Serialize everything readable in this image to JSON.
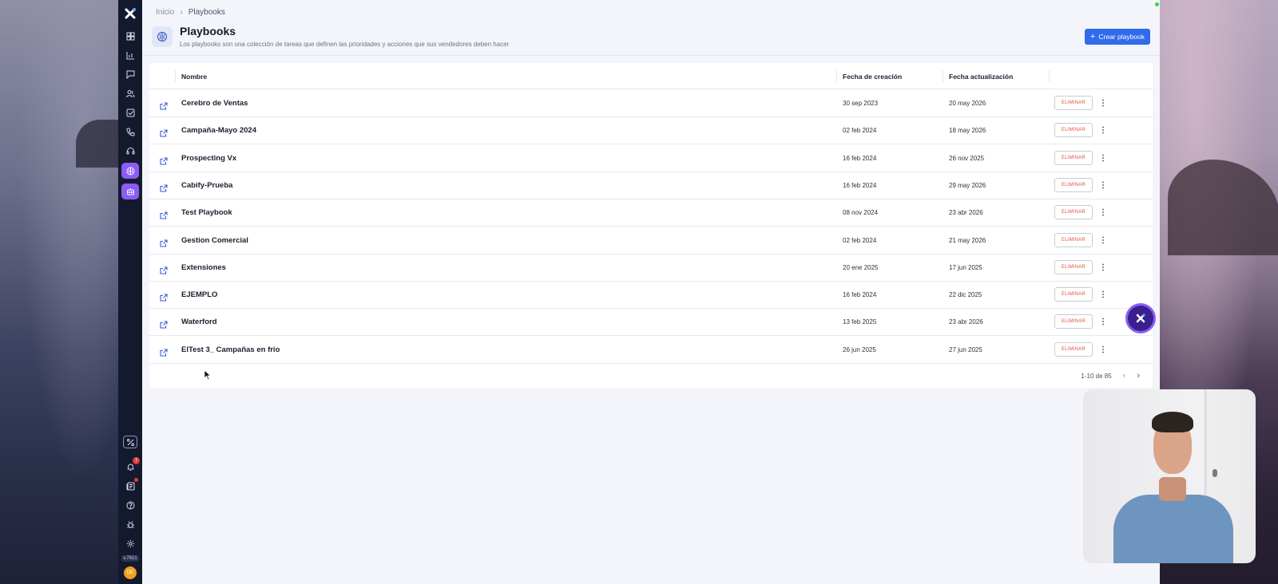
{
  "breadcrumb": {
    "home": "Inicio",
    "separator": "›",
    "current": "Playbooks"
  },
  "header": {
    "title": "Playbooks",
    "subtitle": "Los playbooks son una colección de tareas que definen las prioridades y acciones que sus vendedores deben hacer",
    "create_button": "Crear playbook",
    "icon": "brain-icon"
  },
  "table": {
    "columns": {
      "name": "Nombre",
      "created": "Fecha de creación",
      "updated": "Fecha actualización"
    },
    "delete_label": "ELIMINAR",
    "rows": [
      {
        "name": "Cerebro de Ventas",
        "created": "30 sep 2023",
        "updated": "20 may 2026"
      },
      {
        "name": "Campaña-Mayo 2024",
        "created": "02 feb 2024",
        "updated": "18 may 2026"
      },
      {
        "name": "Prospecting Vx",
        "created": "16 feb 2024",
        "updated": "26 nov 2025"
      },
      {
        "name": "Cabify-Prueba",
        "created": "16 feb 2024",
        "updated": "29 may 2026"
      },
      {
        "name": "Test Playbook",
        "created": "08 nov 2024",
        "updated": "23 abr 2026"
      },
      {
        "name": "Gestion Comercial",
        "created": "02 feb 2024",
        "updated": "21 may 2026"
      },
      {
        "name": "Extensiones",
        "created": "20 ene 2025",
        "updated": "17 jun 2025"
      },
      {
        "name": "EJEMPLO",
        "created": "16 feb 2024",
        "updated": "22 dic 2025"
      },
      {
        "name": "Waterford",
        "created": "13 feb 2025",
        "updated": "23 abr 2026"
      },
      {
        "name": "ElTest 3_ Campañas en frio",
        "created": "26 jun 2025",
        "updated": "27 jun 2025"
      }
    ]
  },
  "pagination": {
    "range": "1-10 de 85",
    "prev": "‹",
    "next": "›"
  },
  "sidebar": {
    "version": "v.7621",
    "avatar_initials": "DE",
    "notification_count": "7",
    "icons": [
      "dashboard-icon",
      "analytics-icon",
      "chat-icon",
      "contacts-icon",
      "tasks-icon",
      "phone-icon",
      "headset-icon",
      "playbooks-icon",
      "bot-icon"
    ]
  },
  "colors": {
    "accent": "#2f6bea",
    "rail": "#141a2e",
    "active": "#8b5cf6",
    "danger": "#e0533c"
  }
}
